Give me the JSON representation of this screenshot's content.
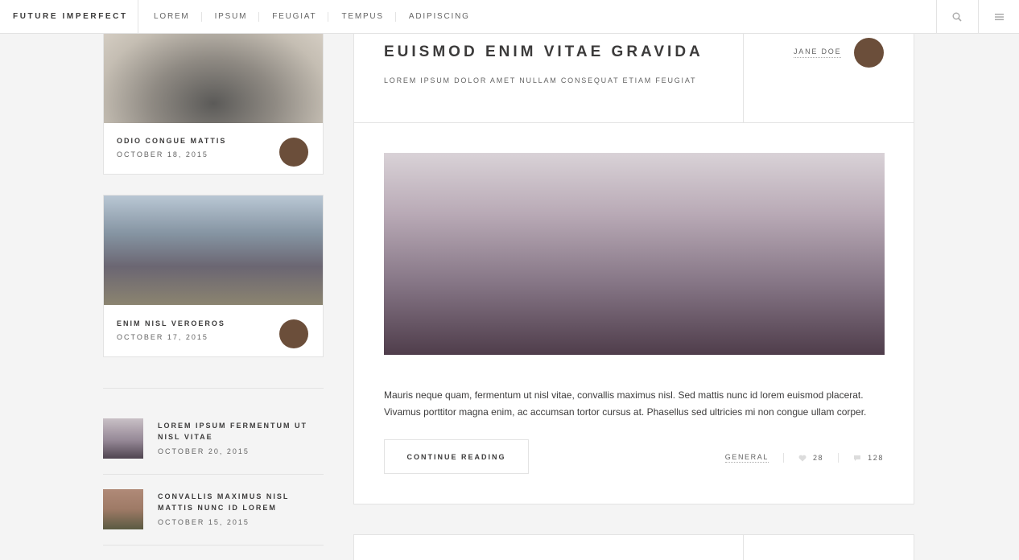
{
  "header": {
    "brand": "FUTURE IMPERFECT",
    "nav": [
      "LOREM",
      "IPSUM",
      "FEUGIAT",
      "TEMPUS",
      "ADIPISCING"
    ]
  },
  "mini_posts": [
    {
      "title": "ODIO CONGUE MATTIS",
      "date": "OCTOBER 18, 2015"
    },
    {
      "title": "ENIM NISL VEROEROS",
      "date": "OCTOBER 17, 2015"
    }
  ],
  "post_list": [
    {
      "title": "LOREM IPSUM FERMENTUM UT NISL VITAE",
      "date": "OCTOBER 20, 2015"
    },
    {
      "title": "CONVALLIS MAXIMUS NISL MATTIS NUNC ID LOREM",
      "date": "OCTOBER 15, 2015"
    }
  ],
  "post": {
    "title": "EUISMOD ENIM VITAE GRAVIDA",
    "subtitle": "LOREM IPSUM DOLOR AMET NULLAM CONSEQUAT ETIAM FEUGIAT",
    "author": "JANE DOE",
    "body": "Mauris neque quam, fermentum ut nisl vitae, convallis maximus nisl. Sed mattis nunc id lorem euismod placerat. Vivamus porttitor magna enim, ac accumsan tortor cursus at. Phasellus sed ultricies mi non congue ullam corper.",
    "continue_label": "CONTINUE READING",
    "category": "GENERAL",
    "likes": "28",
    "comments": "128"
  },
  "colors": {
    "avatar": "#6b4e3a",
    "border": "#e3e3e3",
    "background": "#f4f4f4"
  }
}
